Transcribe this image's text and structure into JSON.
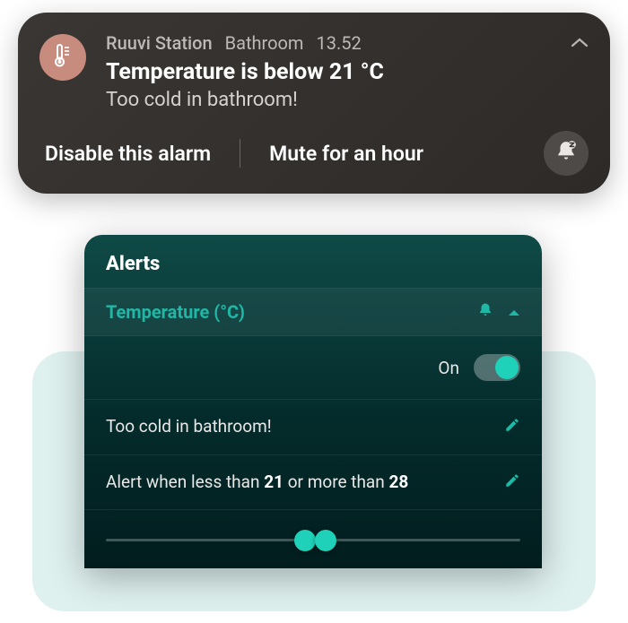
{
  "notification": {
    "app": "Ruuvi Station",
    "location": "Bathroom",
    "time": "13.52",
    "title": "Temperature is below 21 °C",
    "body": "Too cold in bathroom!",
    "actions": {
      "disable": "Disable this alarm",
      "mute": "Mute for an hour"
    },
    "icons": {
      "app": "thermometer-icon",
      "chevron": "chevron-up-icon",
      "bell": "bell-snooze-icon"
    }
  },
  "panel": {
    "header": "Alerts",
    "section": {
      "title": "Temperature (°C)",
      "bell": "bell-icon",
      "caret": "caret-up-icon"
    },
    "toggle": {
      "label": "On",
      "state": true
    },
    "description": "Too cold in bathroom!",
    "rule": {
      "prefix": "Alert when less than ",
      "low": "21",
      "mid": " or more than ",
      "high": "28"
    },
    "slider": {
      "min": -40,
      "max": 85,
      "low": 21,
      "high": 28
    },
    "colors": {
      "accent": "#1fd1b8",
      "accentDim": "#1fb8a6"
    }
  }
}
